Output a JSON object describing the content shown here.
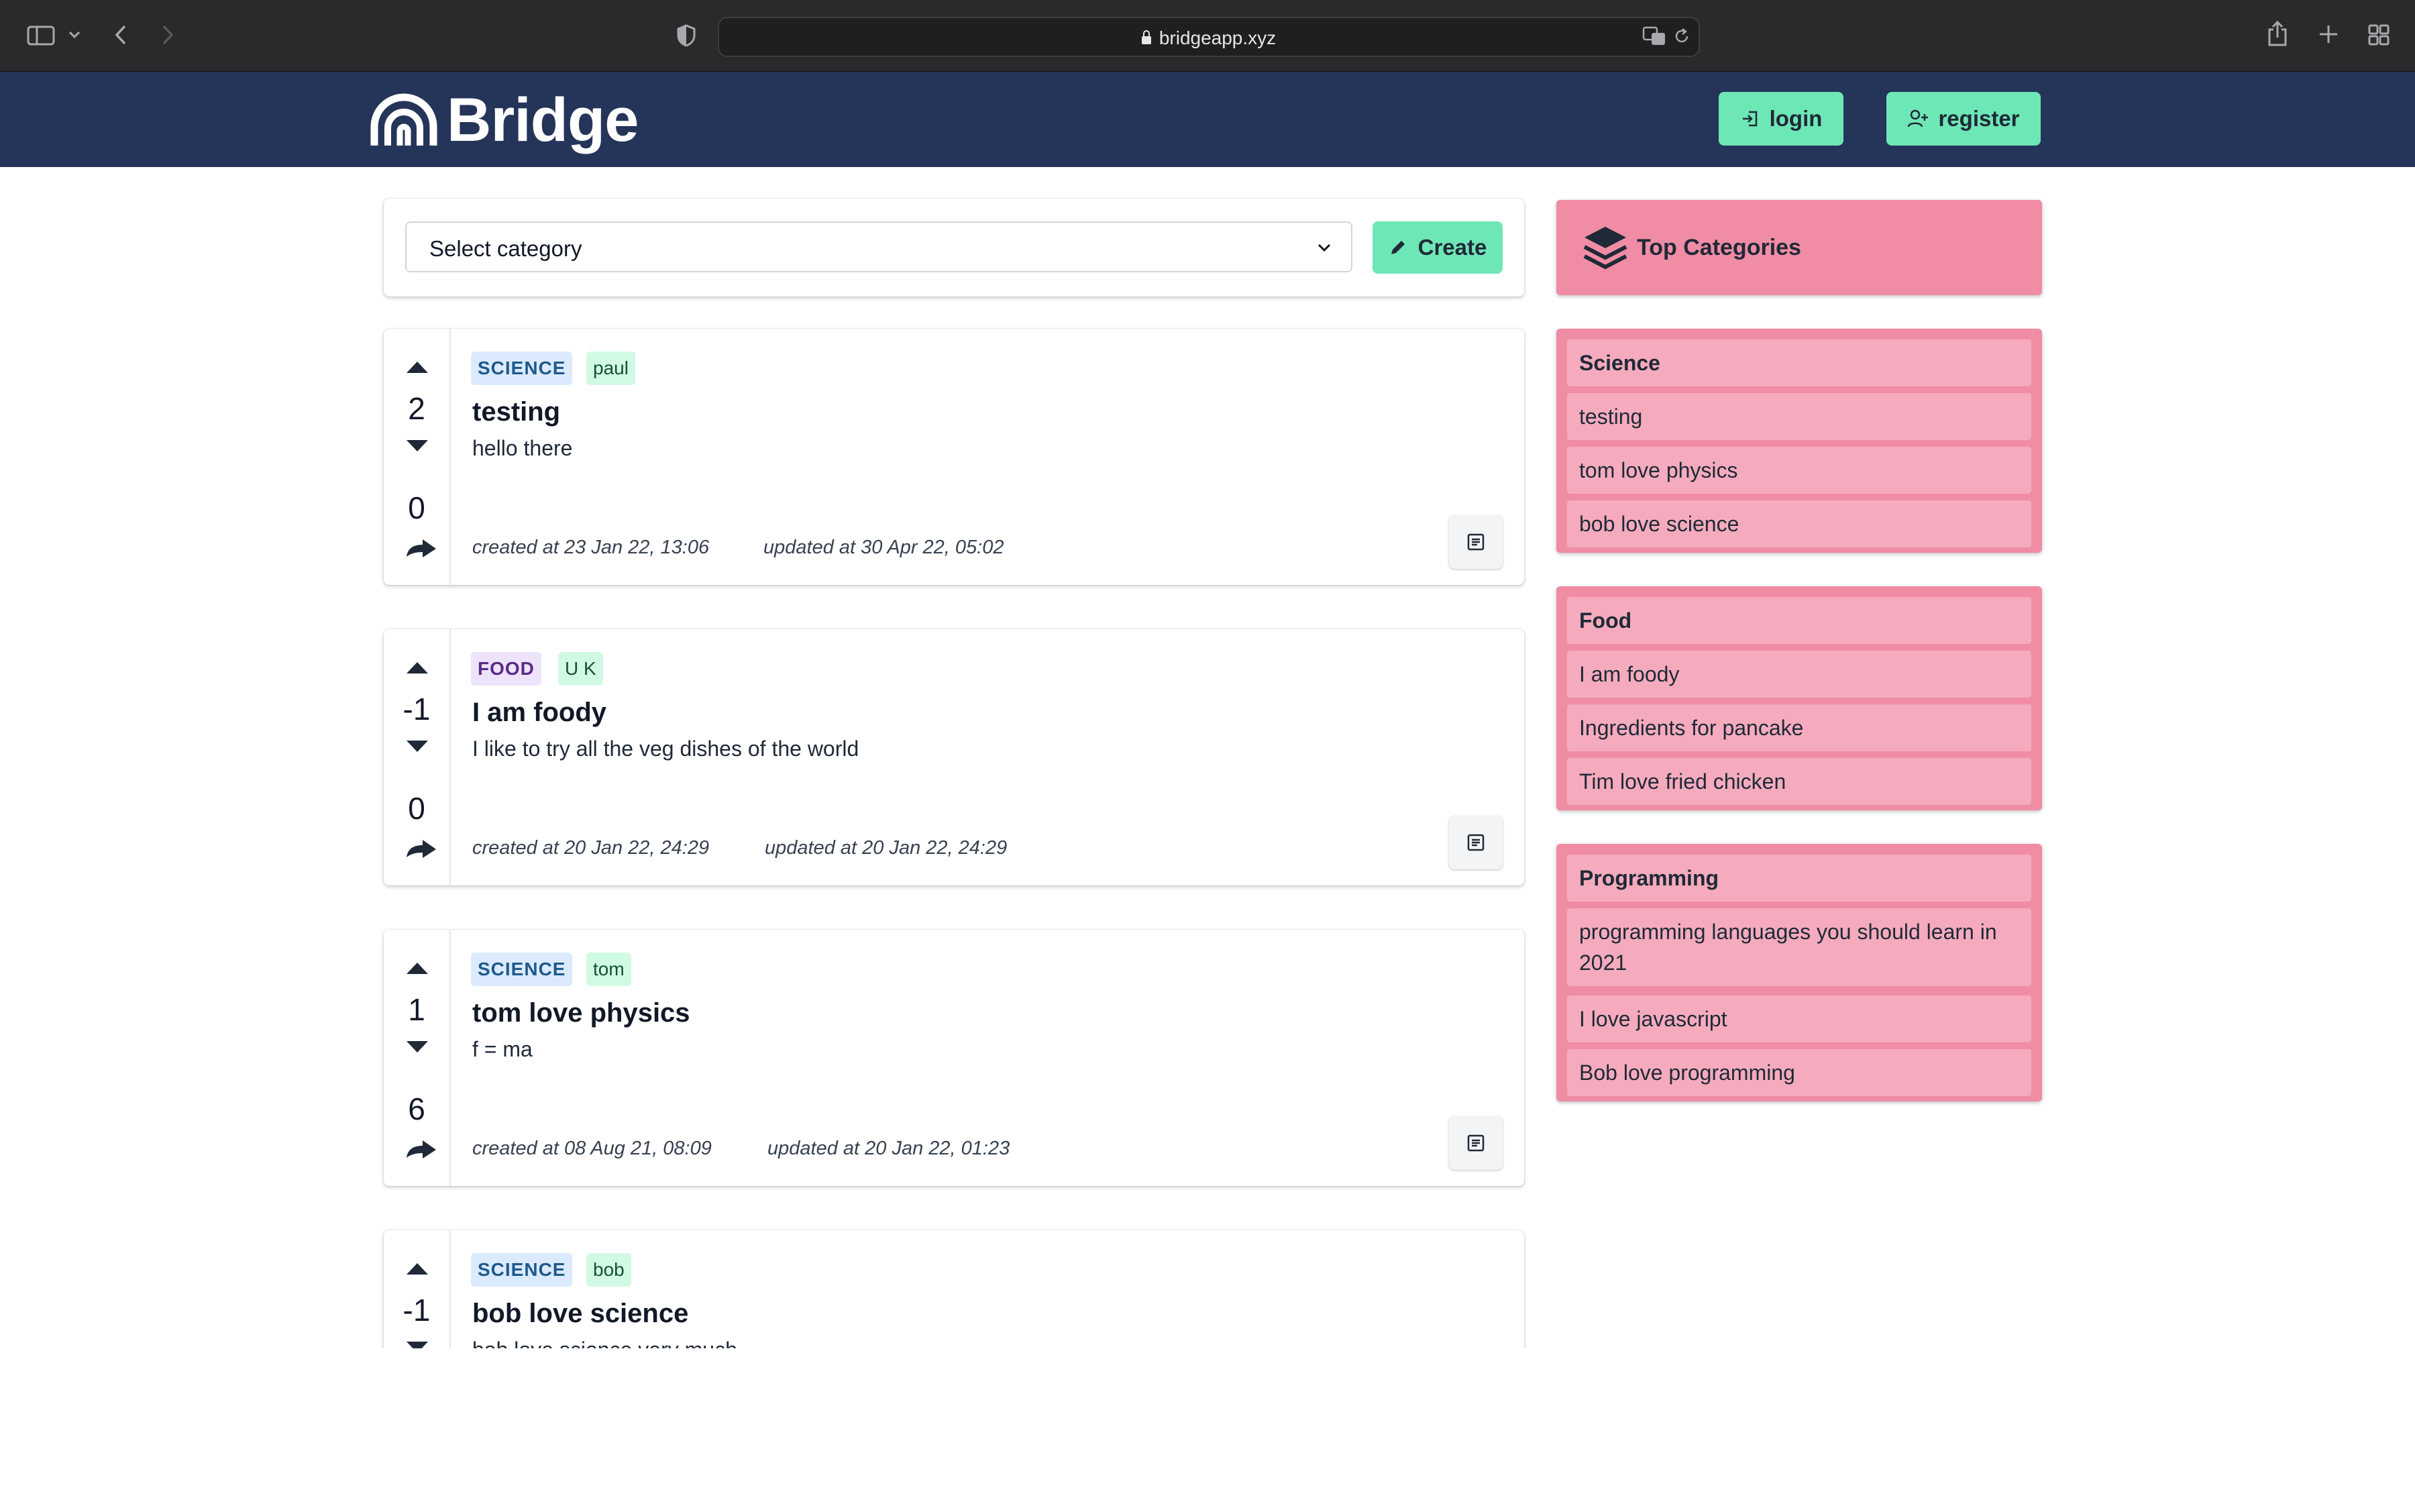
{
  "browser": {
    "url": "bridgeapp.xyz",
    "icons": [
      "sidebar-icon",
      "chevron-down-icon",
      "back-icon",
      "forward-icon",
      "shield-icon",
      "lock-icon",
      "translate-icon",
      "reload-icon",
      "share-icon",
      "new-tab-icon",
      "tabs-overview-icon"
    ]
  },
  "header": {
    "brand": "Bridge",
    "login_label": "login",
    "register_label": "register",
    "background": "#253459",
    "accent": "#6ee7b7"
  },
  "toolbar": {
    "select_value": "Select category",
    "create_label": "Create"
  },
  "posts": [
    {
      "category": "SCIENCE",
      "user": "paul",
      "title": "testing",
      "body": "hello there",
      "score": "2",
      "comments": "0",
      "created": "created at 23 Jan 22, 13:06",
      "updated": "updated at 30 Apr 22, 05:02"
    },
    {
      "category": "FOOD",
      "user": "U K",
      "title": "I am foody",
      "body": "I like to try all the veg dishes of the world",
      "score": "-1",
      "comments": "0",
      "created": "created at 20 Jan 22, 24:29",
      "updated": "updated at 20 Jan 22, 24:29"
    },
    {
      "category": "SCIENCE",
      "user": "tom",
      "title": "tom love physics",
      "body": "f = ma",
      "score": "1",
      "comments": "6",
      "created": "created at 08 Aug 21, 08:09",
      "updated": "updated at 20 Jan 22, 01:23"
    },
    {
      "category": "SCIENCE",
      "user": "bob",
      "title": "bob love science",
      "body": "bob love science very much",
      "score": "-1"
    }
  ],
  "sidebar": {
    "title": "Top Categories",
    "groups": [
      {
        "name": "Science",
        "items": [
          "testing",
          "tom love physics",
          "bob love science"
        ]
      },
      {
        "name": "Food",
        "items": [
          "I am foody",
          "Ingredients for pancake",
          "Tim love fried chicken"
        ]
      },
      {
        "name": "Programming",
        "items": [
          "programming languages you should learn in 2021",
          "I love javascript",
          "Bob love programming"
        ]
      }
    ],
    "color": "#f08ca4"
  }
}
